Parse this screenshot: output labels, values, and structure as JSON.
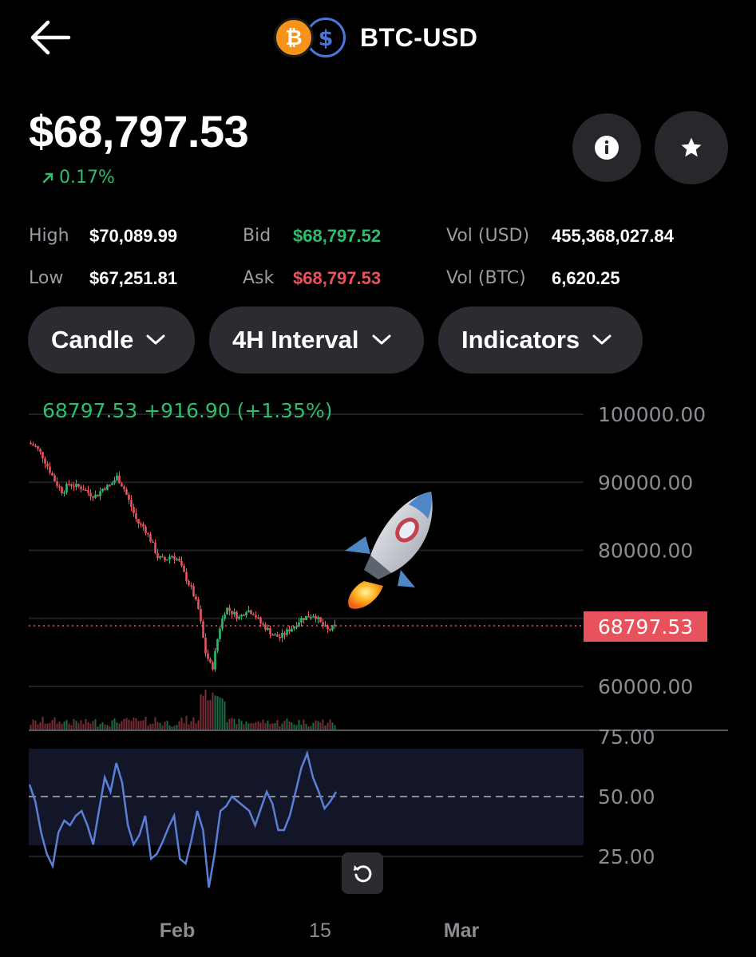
{
  "header": {
    "pair": "BTC-USD",
    "back_icon": "arrow-left-icon",
    "base_coin": "BTC",
    "quote_coin": "USD"
  },
  "price": {
    "value": "$68,797.53",
    "change": "0.17%",
    "change_dir": "up"
  },
  "stats": {
    "high_label": "High",
    "high": "$70,089.99",
    "low_label": "Low",
    "low": "$67,251.81",
    "bid_label": "Bid",
    "bid": "$68,797.52",
    "ask_label": "Ask",
    "ask": "$68,797.53",
    "vol_usd_label": "Vol (USD)",
    "vol_usd": "455,368,027.84",
    "vol_btc_label": "Vol (BTC)",
    "vol_btc": "6,620.25"
  },
  "controls": {
    "chart_type": "Candle",
    "interval": "4H Interval",
    "indicators": "Indicators"
  },
  "colors": {
    "up": "#2ebd6f",
    "down": "#e8525d",
    "rsi": "#5b7fd6",
    "bg": "#000000"
  },
  "chart_data": {
    "type": "candlestick",
    "legend": "68797.53 +916.90 (+1.35%)",
    "last_price": "68797.53",
    "y_ticks": [
      "100000.00",
      "90000.00",
      "80000.00",
      "70000.00",
      "60000.00"
    ],
    "ylim": [
      57000,
      100000
    ],
    "x_ticks": [
      "Feb",
      "15",
      "Mar"
    ],
    "price_path": [
      [
        0,
        95800
      ],
      [
        3,
        95300
      ],
      [
        6,
        94000
      ],
      [
        9,
        92000
      ],
      [
        12,
        90000
      ],
      [
        15,
        88600
      ],
      [
        18,
        89800
      ],
      [
        21,
        89400
      ],
      [
        24,
        89200
      ],
      [
        27,
        88300
      ],
      [
        30,
        88000
      ],
      [
        33,
        89200
      ],
      [
        36,
        89500
      ],
      [
        39,
        90800
      ],
      [
        42,
        89200
      ],
      [
        45,
        86700
      ],
      [
        48,
        84100
      ],
      [
        51,
        83400
      ],
      [
        54,
        81400
      ],
      [
        57,
        79000
      ],
      [
        60,
        78500
      ],
      [
        63,
        79300
      ],
      [
        66,
        78600
      ],
      [
        69,
        76200
      ],
      [
        72,
        74200
      ],
      [
        75,
        71200
      ],
      [
        78,
        65000
      ],
      [
        81,
        62500
      ],
      [
        84,
        68300
      ],
      [
        87,
        71600
      ],
      [
        90,
        70800
      ],
      [
        93,
        70100
      ],
      [
        96,
        71300
      ],
      [
        99,
        70900
      ],
      [
        102,
        69400
      ],
      [
        105,
        68500
      ],
      [
        108,
        67500
      ],
      [
        111,
        67200
      ],
      [
        114,
        68100
      ],
      [
        117,
        68900
      ],
      [
        120,
        69900
      ],
      [
        123,
        70300
      ],
      [
        126,
        70600
      ],
      [
        129,
        69100
      ],
      [
        132,
        68200
      ],
      [
        135,
        68797
      ]
    ],
    "rsi": {
      "levels": [
        "75.00",
        "50.00",
        "25.00"
      ],
      "values": [
        55,
        48,
        35,
        26,
        21,
        35,
        40,
        38,
        42,
        44,
        38,
        30,
        44,
        58,
        52,
        64,
        56,
        38,
        30,
        34,
        42,
        24,
        26,
        31,
        37,
        42,
        24,
        22,
        32,
        44,
        36,
        12,
        26,
        44,
        46,
        50,
        48,
        46,
        44,
        38,
        45,
        52,
        47,
        36,
        36,
        42,
        52,
        62,
        68,
        58,
        52,
        45,
        48,
        52
      ]
    }
  }
}
